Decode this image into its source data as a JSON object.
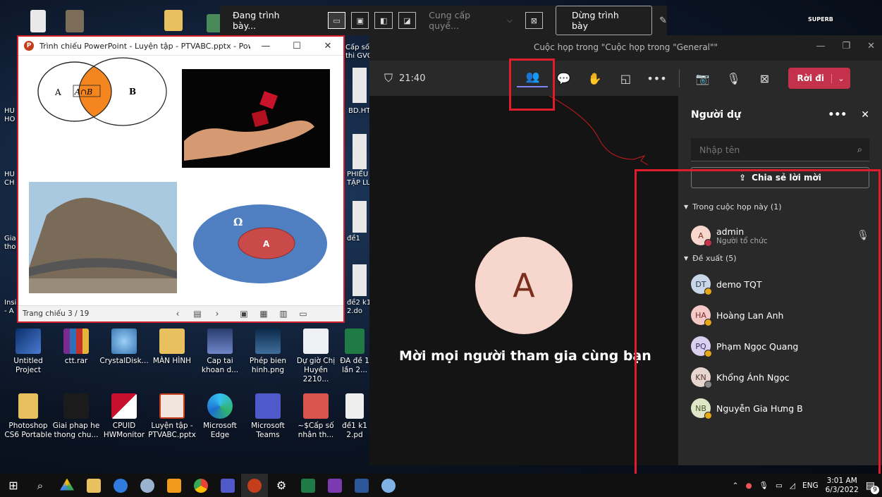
{
  "presenter_bar": {
    "presenting_label": "Đang trình bày...",
    "give_control_label": "Cung cấp quyề...",
    "stop_presenting_label": "Dừng trình bày"
  },
  "ppt_window": {
    "title": "Trình chiếu PowerPoint  -  Luyện tập - PTVABC.pptx - PowerP...",
    "status": "Trang chiếu 3 / 19",
    "slide": {
      "venn_left": "A",
      "venn_mid": "A∩B",
      "venn_right": "B",
      "omega": "Ω",
      "inner_a": "A"
    }
  },
  "teams": {
    "window_title": "Cuộc họp trong \"Cuộc họp trong \"General\"\"",
    "timer": "21:40",
    "leave_label": "Rời đi",
    "stage": {
      "avatar_letter": "A",
      "invite_text": "Mời mọi người tham gia cùng bạn"
    },
    "panel": {
      "title": "Người dự",
      "search_placeholder": "Nhập tên",
      "share_invite_label": "Chia sẻ lời mời",
      "in_meeting_label": "Trong cuộc họp này (1)",
      "suggested_label": "Đề xuất (5)",
      "organizer": {
        "initials": "A",
        "name": "admin",
        "role": "Người tổ chức"
      },
      "suggested": [
        {
          "initials": "DT",
          "name": "demo TQT",
          "color": "#c9d6e8"
        },
        {
          "initials": "HA",
          "name": "Hoàng Lan Anh",
          "color": "#f6c9c9"
        },
        {
          "initials": "PQ",
          "name": "Phạm Ngọc Quang",
          "color": "#d8d0ee"
        },
        {
          "initials": "KN",
          "name": "Khổng Ánh Ngọc",
          "color": "#e7d6cf"
        },
        {
          "initials": "NB",
          "name": "Nguyễn Gia Hưng B",
          "color": "#dfe6c8"
        }
      ]
    }
  },
  "desktop": {
    "row1": [
      "Untitled Project",
      "ctt.rar",
      "CrystalDisk...",
      "MÀN HÌNH",
      "Cap tai khoan d...",
      "Phép bien hinh.png",
      "Dự giờ Chị Huyền 2210...",
      "ĐA đề 1 lần 2..."
    ],
    "row2": [
      "Photoshop CS6 Portable",
      "Giai phap he thong chu...",
      "CPUID HWMonitor",
      "Luyện tập - PTVABC.pptx",
      "Microsoft Edge",
      "Microsoft Teams",
      "~$Cấp số nhân th...",
      "đề1 k1 2.pd"
    ],
    "right_edge": [
      "Cấp số\nthi GVG",
      "BD.HT",
      "PHIẾU\nTẬP LU",
      "đề1",
      "đề2 k1\n2.do"
    ],
    "left_edge": [
      "HU\nHO",
      "HU\nCH",
      "Gia\ntho",
      "Insi\n- A"
    ],
    "top_right_label": "SUPERB"
  },
  "taskbar": {
    "lang": "ENG",
    "time": "3:01 AM",
    "date": "6/3/2022",
    "notifications": "9"
  }
}
